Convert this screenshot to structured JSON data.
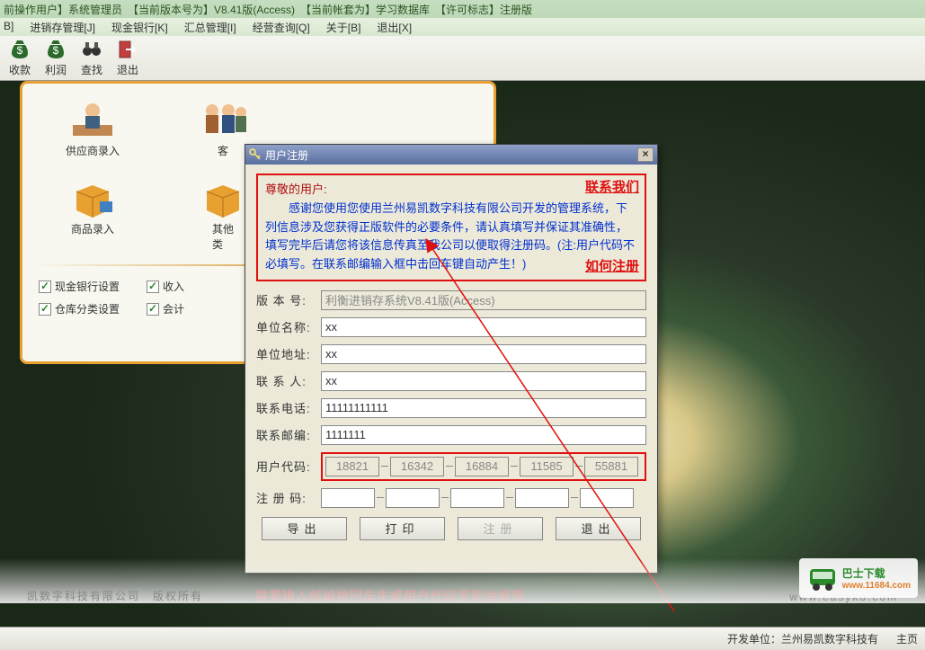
{
  "titlebar": "前操作用户】系统管理员　【当前版本号为】V8.41版(Access)　【当前帐套为】学习数据库　【许可标志】注册版",
  "menu": {
    "m1": "B]",
    "m2": "进销存管理[J]",
    "m3": "现金银行[K]",
    "m4": "汇总管理[I]",
    "m5": "经营查询[Q]",
    "m6": "关于[B]",
    "m7": "退出[X]"
  },
  "tool": {
    "t1": "收款",
    "t2": "利润",
    "t3": "查找",
    "t4": "退出"
  },
  "panel": {
    "i1": "供应商录入",
    "i2": "客",
    "i3": "商品录入",
    "i4": "其他",
    "i4b": "类",
    "c1": "现金银行设置",
    "c2": "收入",
    "c3": "仓库分类设置",
    "c4": "会计"
  },
  "dialog": {
    "title": "用户注册",
    "greet": "尊敬的用户:",
    "msg": "感谢您使用您使用兰州易凯数字科技有限公司开发的管理系统，下列信息涉及您获得正版软件的必要条件，请认真填写并保证其准确性，填写完毕后请您将该信息传真至我公司以便取得注册码。(注:用户代码不必填写。在联系邮编输入框中击回车键自动产生！)",
    "contact": "联系我们",
    "howto": "如何注册",
    "labels": {
      "ver": "版 本 号:",
      "unit": "单位名称:",
      "addr": "单位地址:",
      "person": "联 系 人:",
      "phone": "联系电话:",
      "zip": "联系邮编:",
      "ucode": "用户代码:",
      "rcode": "注 册 码:"
    },
    "vals": {
      "ver": "利衡进销存系统V8.41版(Access)",
      "unit": "xx",
      "addr": "xx",
      "person": "xx",
      "phone": "11111111111",
      "zip": "1111111",
      "u1": "18821",
      "u2": "16342",
      "u3": "16884",
      "u4": "11585",
      "u5": "55881"
    },
    "btns": {
      "export": "导出",
      "print": "打印",
      "reg": "注册",
      "exit": "退出"
    }
  },
  "annot": "需要输入邮编按回车生成用户代码否则会报错",
  "footer": {
    "left": "凯数字科技有限公司　版权所有",
    "right": "www.easyko.com"
  },
  "logo": {
    "line1": "巴士下载",
    "line2": "www.11684.com"
  },
  "status": {
    "s1": "开发单位：兰州易凯数字科技有",
    "s2": "主页"
  }
}
